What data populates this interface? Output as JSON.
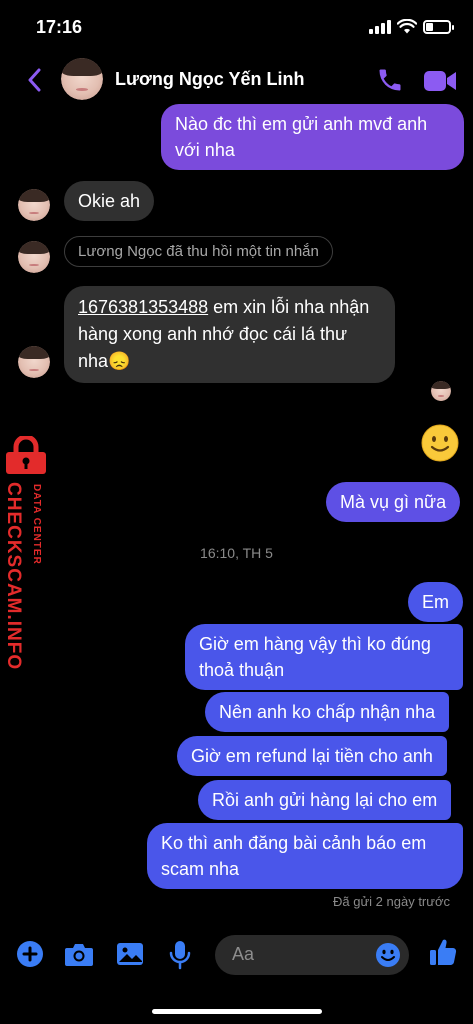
{
  "status_bar": {
    "time": "17:16"
  },
  "header": {
    "contact_name": "Lương Ngọc Yến Linh"
  },
  "messages": [
    {
      "direction": "out",
      "text": "Nào đc thì em gửi anh mvđ anh với nha"
    },
    {
      "direction": "in",
      "text": "Okie ah"
    },
    {
      "direction": "in-recall",
      "text": "Lương Ngọc đã thu hồi một tin nhắn"
    },
    {
      "direction": "in",
      "link_text": "1676381353488",
      "text": " em xin lỗi nha nhận hàng xong anh nhớ đọc cái lá thư nha😞"
    },
    {
      "direction": "out-emoji",
      "text": "🙂"
    },
    {
      "direction": "out",
      "text": "Mà vụ gì nữa"
    },
    {
      "direction": "out",
      "text": "Em"
    },
    {
      "direction": "out",
      "text": "Giờ em hàng vậy thì ko đúng thoả thuận"
    },
    {
      "direction": "out",
      "text": "Nên anh ko chấp nhận nha"
    },
    {
      "direction": "out",
      "text": "Giờ em refund lại tiền cho anh"
    },
    {
      "direction": "out",
      "text": "Rồi anh gửi hàng lại cho em"
    },
    {
      "direction": "out",
      "text": "Ko thì anh đăng bài cảnh báo em scam nha"
    }
  ],
  "timestamp": "16:10, TH 5",
  "sent_status": "Đã gửi 2 ngày trước",
  "watermark": {
    "main": "CHECKSCAM.INFO",
    "sub": "DATA CENTER"
  },
  "composer": {
    "placeholder": "Aa"
  },
  "colors": {
    "accent": "#8c5bf2",
    "bubble_incoming": "#303030",
    "bubble_purple": "#7b4bdc",
    "bubble_blue": "#4a56ea",
    "composer_icon": "#3a7df5",
    "watermark": "#e32b2b"
  },
  "icons": [
    "back-chevron-icon",
    "phone-icon",
    "video-icon",
    "plus-icon",
    "camera-icon",
    "image-icon",
    "microphone-icon",
    "emoji-icon",
    "thumbs-up-icon",
    "lock-icon"
  ]
}
